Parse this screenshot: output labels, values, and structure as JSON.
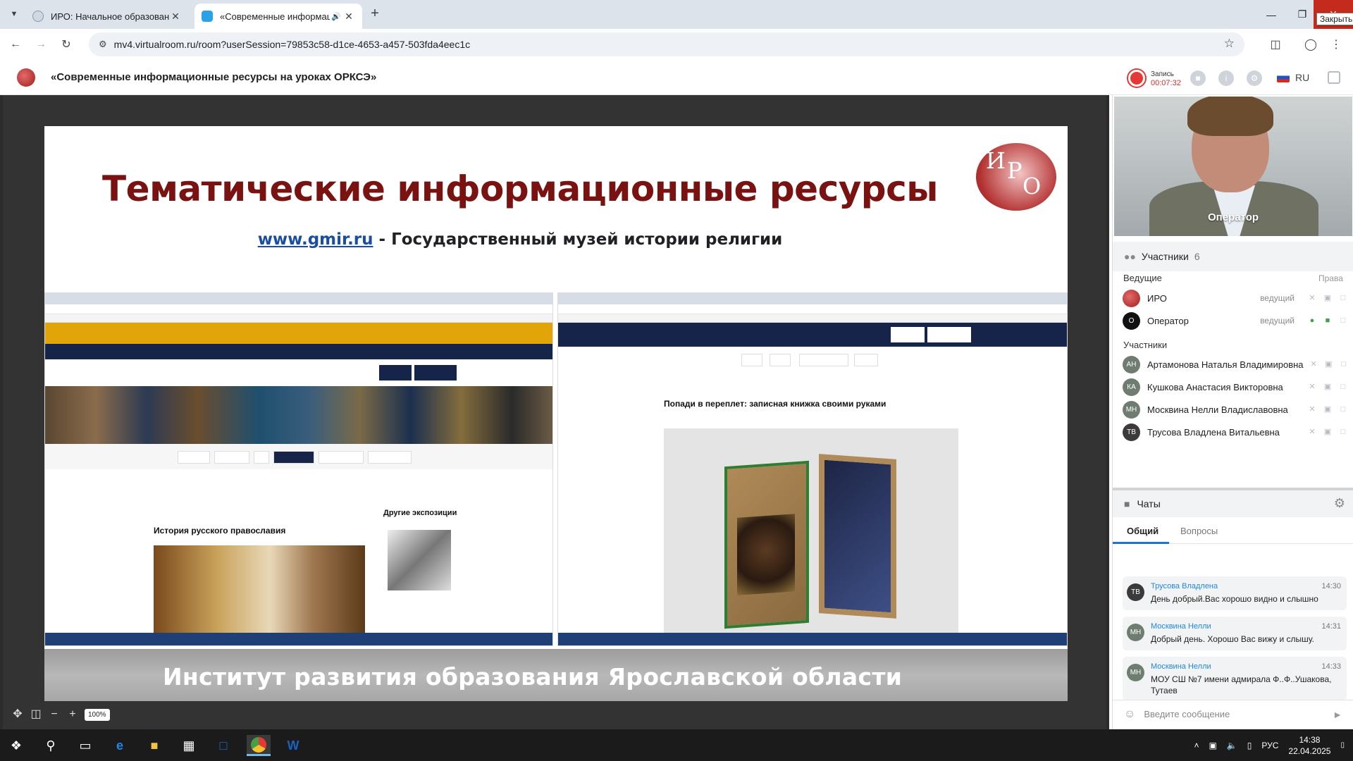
{
  "browser": {
    "tabs": [
      {
        "title": "ИРО: Начальное образование",
        "active": false
      },
      {
        "title": "«Современные информац",
        "active": true
      }
    ],
    "url": "mv4.virtualroom.ru/room?userSession=79853c58-d1ce-4653-a457-503fda4eec1c",
    "close_tooltip": "Закрыть"
  },
  "app": {
    "room_title": "«Современные информационные ресурсы на уроках ОРКСЭ»",
    "record_label": "Запись",
    "record_time": "00:07:32",
    "lang": "RU"
  },
  "slide": {
    "title": "Тематические информационные ресурсы",
    "link": "www.gmir.ru",
    "link_desc": " - Государственный музей истории религии",
    "logo_letters": [
      "И",
      "Р",
      "О"
    ],
    "left_shot": {
      "heading": "История русского православия",
      "side_heading": "Другие экспозиции"
    },
    "right_shot": {
      "heading": "Попади в переплет: записная книжка своими руками"
    },
    "footer": "Институт развития образования Ярославской области"
  },
  "zoom": "100%",
  "video": {
    "name": "Оператор"
  },
  "participants": {
    "label": "Участники",
    "count": "6",
    "hosts_label": "Ведущие",
    "rights_label": "Права",
    "hosts": [
      {
        "initials": "",
        "name": "ИРО",
        "role": "ведущий",
        "color": "#b52a2a"
      },
      {
        "initials": "О",
        "name": "Оператор",
        "role": "ведущий",
        "color": "#111111"
      }
    ],
    "members_label": "Участники",
    "members": [
      {
        "initials": "АН",
        "name": "Артамонова Наталья Владимировна"
      },
      {
        "initials": "КА",
        "name": "Кушкова Анастасия Викторовна"
      },
      {
        "initials": "МН",
        "name": "Москвина Нелли Владиславовна"
      },
      {
        "initials": "ТВ",
        "name": "Трусова Владлена Витальевна"
      }
    ]
  },
  "chat": {
    "label": "Чаты",
    "tabs": [
      "Общий",
      "Вопросы"
    ],
    "messages": [
      {
        "initials": "ТВ",
        "author": "Трусова Владлена",
        "time": "14:30",
        "text": "День добрый.Вас хорошо видно и слышно"
      },
      {
        "initials": "МН",
        "author": "Москвина Нелли",
        "time": "14:31",
        "text": "Добрый день. Хорошо Вас вижу и слышу."
      },
      {
        "initials": "МН",
        "author": "Москвина Нелли",
        "time": "14:33",
        "text": "МОУ СШ №7 имени адмирала Ф..Ф..Ушакова, Тутаев"
      }
    ],
    "input_placeholder": "Введите сообщение"
  },
  "taskbar": {
    "lang": "РУС",
    "time": "14:38",
    "date": "22.04.2025"
  }
}
